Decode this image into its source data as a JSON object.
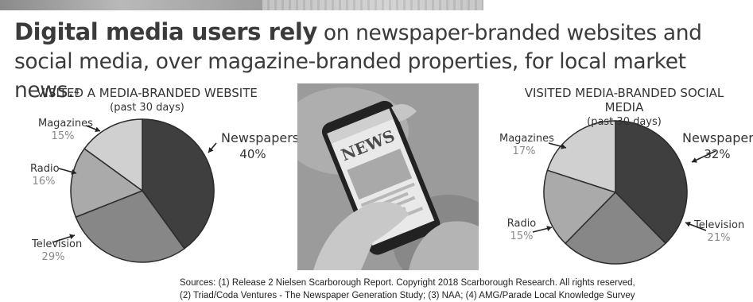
{
  "headline": {
    "bold": "Digital media users rely",
    "rest": " on newspaper-branded websites and social media, over magazine-branded properties, for local market news.",
    "footnote": "4"
  },
  "chart_data": [
    {
      "type": "pie",
      "title": "VISITED A MEDIA-BRANDED WEBSITE",
      "subtitle": "(past 30 days)",
      "slices": [
        {
          "label": "Newspapers",
          "value": 40,
          "value_label": "40%",
          "color": "#3f3f3f"
        },
        {
          "label": "Television",
          "value": 29,
          "value_label": "29%",
          "color": "#878787"
        },
        {
          "label": "Radio",
          "value": 16,
          "value_label": "16%",
          "color": "#aaaaaa"
        },
        {
          "label": "Magazines",
          "value": 15,
          "value_label": "15%",
          "color": "#d0d0d0"
        }
      ]
    },
    {
      "type": "pie",
      "title": "VISITED MEDIA-BRANDED SOCIAL MEDIA",
      "subtitle": "(past 30 days)",
      "slices": [
        {
          "label": "Newspapers",
          "value": 32,
          "value_label": "32%",
          "color": "#3f3f3f"
        },
        {
          "label": "Television",
          "value": 21,
          "value_label": "21%",
          "color": "#878787"
        },
        {
          "label": "Radio",
          "value": 15,
          "value_label": "15%",
          "color": "#aaaaaa"
        },
        {
          "label": "Magazines",
          "value": 17,
          "value_label": "17%",
          "color": "#d0d0d0"
        }
      ]
    }
  ],
  "photo": {
    "screen_text": "NEWS"
  },
  "sources": {
    "line1": "Sources: (1) Release 2 Nielsen Scarborough Report. Copyright 2018 Scarborough Research. All rights reserved,",
    "line2": "(2) Triad/Coda Ventures - The Newspaper Generation Study; (3) NAA; (4) AMG/Parade Local Knowledge Survey"
  }
}
